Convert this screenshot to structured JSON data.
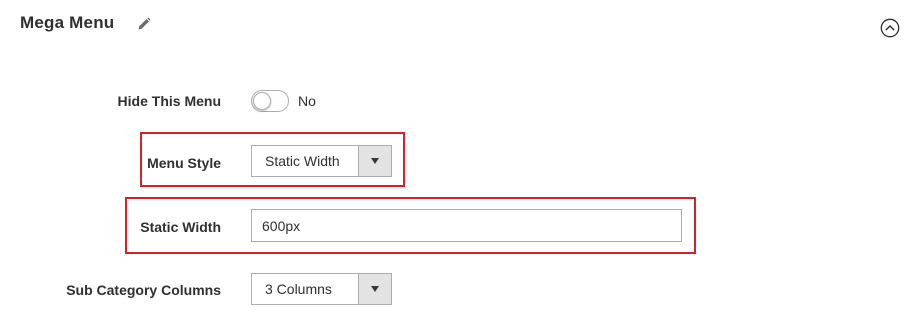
{
  "section": {
    "title": "Mega Menu",
    "edit_icon": "pencil-icon",
    "collapse_icon": "chevron-up-circle-icon"
  },
  "fields": {
    "hide_menu": {
      "label": "Hide This Menu",
      "value_text": "No",
      "enabled": false
    },
    "menu_style": {
      "label": "Menu Style",
      "selected": "Static Width"
    },
    "static_width": {
      "label": "Static Width",
      "value": "600px"
    },
    "sub_category_columns": {
      "label": "Sub Category Columns",
      "selected": "3 Columns"
    }
  },
  "colors": {
    "highlight": "#d8202a",
    "text": "#303030",
    "border": "#adadad",
    "select_button": "#e3e3e3"
  }
}
